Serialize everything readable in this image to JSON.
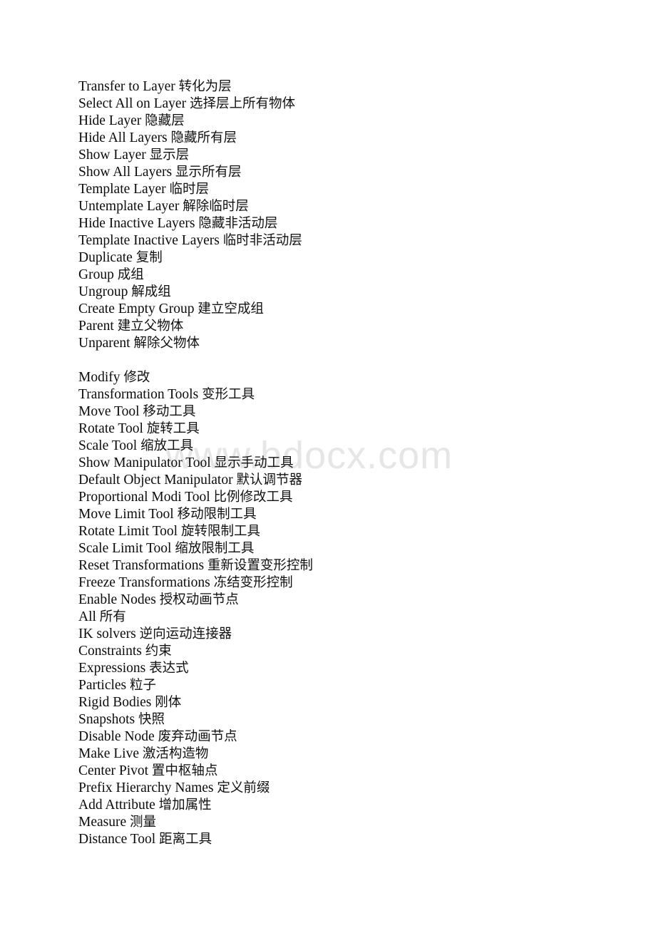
{
  "page": {
    "background_color": "#ffffff",
    "text_color": "#000000",
    "watermark": {
      "text": "www.bdocx.com",
      "color": "#e6e6e6"
    }
  },
  "sections": [
    {
      "name": "layer-and-group-commands",
      "lines": [
        {
          "term": "Transfer to Layer",
          "gloss": "转化为层"
        },
        {
          "term": "Select All on Layer",
          "gloss": "选择层上所有物体"
        },
        {
          "term": "Hide Layer",
          "gloss": "隐藏层"
        },
        {
          "term": "Hide All Layers",
          "gloss": "隐藏所有层"
        },
        {
          "term": "Show Layer",
          "gloss": "显示层"
        },
        {
          "term": "Show All Layers",
          "gloss": "显示所有层"
        },
        {
          "term": "Template Layer",
          "gloss": "临时层"
        },
        {
          "term": "Untemplate Layer",
          "gloss": "解除临时层"
        },
        {
          "term": "Hide Inactive Layers",
          "gloss": "隐藏非活动层"
        },
        {
          "term": "Template Inactive Layers",
          "gloss": "临时非活动层"
        },
        {
          "term": "Duplicate",
          "gloss": "复制"
        },
        {
          "term": "Group",
          "gloss": "成组"
        },
        {
          "term": "Ungroup",
          "gloss": "解成组"
        },
        {
          "term": "Create Empty Group",
          "gloss": "建立空成组"
        },
        {
          "term": "Parent",
          "gloss": "建立父物体"
        },
        {
          "term": "Unparent",
          "gloss": "解除父物体"
        }
      ]
    },
    {
      "name": "modify-menu-commands",
      "lines": [
        {
          "term": "Modify",
          "gloss": "修改"
        },
        {
          "term": "Transformation Tools",
          "gloss": "变形工具"
        },
        {
          "term": "Move Tool",
          "gloss": "移动工具"
        },
        {
          "term": "Rotate Tool",
          "gloss": "旋转工具"
        },
        {
          "term": "Scale Tool",
          "gloss": "缩放工具"
        },
        {
          "term": "Show Manipulator Tool",
          "gloss": "显示手动工具"
        },
        {
          "term": "Default Object Manipulator",
          "gloss": "默认调节器"
        },
        {
          "term": "Proportional Modi Tool",
          "gloss": "比例修改工具"
        },
        {
          "term": "Move Limit Tool",
          "gloss": "移动限制工具"
        },
        {
          "term": "Rotate Limit Tool",
          "gloss": "旋转限制工具"
        },
        {
          "term": "Scale Limit Tool",
          "gloss": "缩放限制工具"
        },
        {
          "term": "Reset Transformations",
          "gloss": "重新设置变形控制"
        },
        {
          "term": "Freeze Transformations",
          "gloss": "冻结变形控制"
        },
        {
          "term": "Enable Nodes",
          "gloss": "授权动画节点"
        },
        {
          "term": "All",
          "gloss": "所有"
        },
        {
          "term": "IK solvers",
          "gloss": "逆向运动连接器"
        },
        {
          "term": "Constraints",
          "gloss": "约束"
        },
        {
          "term": "Expressions",
          "gloss": "表达式"
        },
        {
          "term": "Particles",
          "gloss": "粒子"
        },
        {
          "term": "Rigid Bodies",
          "gloss": "刚体"
        },
        {
          "term": "Snapshots",
          "gloss": "快照"
        },
        {
          "term": "Disable Node",
          "gloss": "废弃动画节点"
        },
        {
          "term": "Make Live",
          "gloss": "激活构造物"
        },
        {
          "term": "Center Pivot",
          "gloss": "置中枢轴点"
        },
        {
          "term": "Prefix Hierarchy Names",
          "gloss": "定义前缀"
        },
        {
          "term": "Add Attribute",
          "gloss": "增加属性"
        },
        {
          "term": "Measure",
          "gloss": "测量"
        },
        {
          "term": "Distance Tool",
          "gloss": "距离工具"
        }
      ]
    }
  ]
}
